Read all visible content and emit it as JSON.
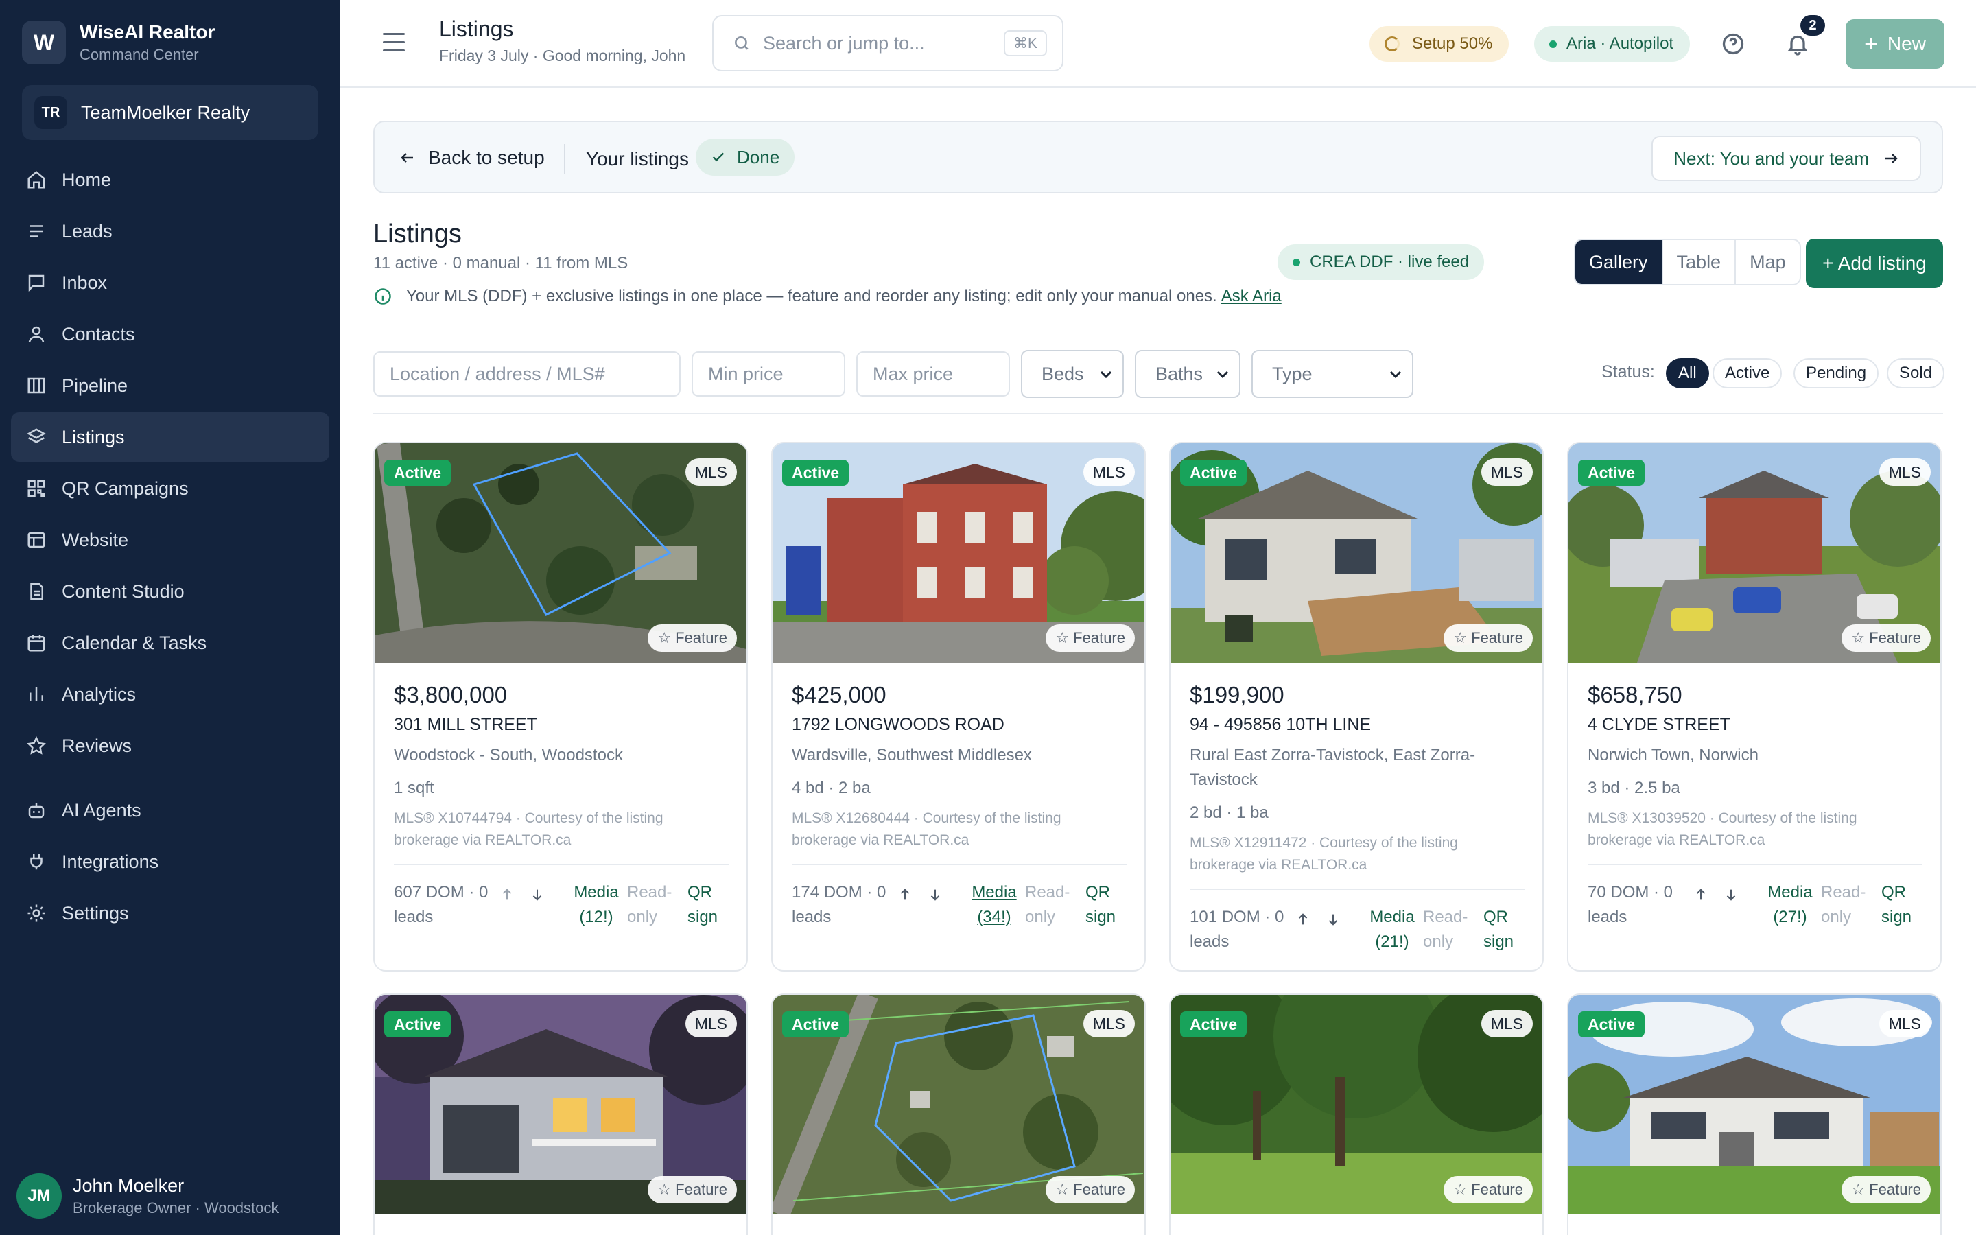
{
  "brand": {
    "logo": "W",
    "name": "WiseAI Realtor",
    "sub": "Command Center"
  },
  "team": {
    "initials": "TR",
    "name": "TeamMoelker Realty"
  },
  "nav": [
    {
      "label": "Home",
      "icon": "home-icon"
    },
    {
      "label": "Leads",
      "icon": "list-icon"
    },
    {
      "label": "Inbox",
      "icon": "inbox-icon"
    },
    {
      "label": "Contacts",
      "icon": "user-icon"
    },
    {
      "label": "Pipeline",
      "icon": "columns-icon"
    },
    {
      "label": "Listings",
      "icon": "layers-icon",
      "active": true
    },
    {
      "label": "QR Campaigns",
      "icon": "qr-icon"
    },
    {
      "label": "Website",
      "icon": "browser-icon"
    },
    {
      "label": "Content Studio",
      "icon": "document-icon"
    },
    {
      "label": "Calendar & Tasks",
      "icon": "calendar-icon"
    },
    {
      "label": "Analytics",
      "icon": "bar-chart-icon"
    },
    {
      "label": "Reviews",
      "icon": "star-icon"
    },
    {
      "label": "AI Agents",
      "icon": "bot-icon"
    },
    {
      "label": "Integrations",
      "icon": "plug-icon"
    },
    {
      "label": "Settings",
      "icon": "gear-icon"
    }
  ],
  "user": {
    "initials": "JM",
    "name": "John Moelker",
    "role": "Brokerage Owner · Woodstock"
  },
  "topbar": {
    "title": "Listings",
    "subtitle": "Friday 3 July · Good morning, John",
    "search_placeholder": "Search or jump to...",
    "shortcut": "⌘K",
    "setup_label": "Setup 50%",
    "setup_progress": 0.5,
    "aria_label": "Aria · Autopilot",
    "notifications": "2",
    "new_label": "New"
  },
  "setup_bar": {
    "back": "Back to setup",
    "step": "Your listings",
    "done": "Done",
    "next": "Next: You and your team"
  },
  "listings_header": {
    "title": "Listings",
    "counts": "11 active · 0 manual · 11 from MLS",
    "info": "Your MLS (DDF) + exclusive listings in one place — feature and reorder any listing; edit only your manual ones.",
    "ask_aria": "Ask Aria",
    "feed": "CREA DDF · live feed",
    "views": [
      "Gallery",
      "Table",
      "Map"
    ],
    "active_view": "Gallery",
    "add_listing": "+ Add listing"
  },
  "filters": {
    "location_placeholder": "Location / address / MLS#",
    "min_price_placeholder": "Min price",
    "max_price_placeholder": "Max price",
    "beds": "Beds",
    "baths": "Baths",
    "type": "Type",
    "status_label": "Status:",
    "statuses": [
      "All",
      "Active",
      "Pending",
      "Sold"
    ],
    "active_status": "All"
  },
  "card_labels": {
    "feature": "☆ Feature",
    "read_only": "Read-only",
    "qr_sign": "QR sign"
  },
  "listings": [
    {
      "status": "Active",
      "source": "MLS",
      "price": "$3,800,000",
      "address": "301 MILL STREET",
      "city": "Woodstock - South, Woodstock",
      "specs": "1 sqft",
      "mls": "MLS® X10744794 · Courtesy of the listing brokerage via REALTOR.ca",
      "dom": "607 DOM · 0 leads",
      "media": "Media (12!)"
    },
    {
      "status": "Active",
      "source": "MLS",
      "price": "$425,000",
      "address": "1792 LONGWOODS ROAD",
      "city": "Wardsville, Southwest Middlesex",
      "specs": "4 bd · 2 ba",
      "mls": "MLS® X12680444 · Courtesy of the listing brokerage via REALTOR.ca",
      "dom": "174 DOM · 0 leads",
      "media": "Media (34!)"
    },
    {
      "status": "Active",
      "source": "MLS",
      "price": "$199,900",
      "address": "94 - 495856 10TH LINE",
      "city": "Rural East Zorra-Tavistock, East Zorra-Tavistock",
      "specs": "2 bd · 1 ba",
      "mls": "MLS® X12911472 · Courtesy of the listing brokerage via REALTOR.ca",
      "dom": "101 DOM · 0 leads",
      "media": "Media (21!)"
    },
    {
      "status": "Active",
      "source": "MLS",
      "price": "$658,750",
      "address": "4 CLYDE STREET",
      "city": "Norwich Town, Norwich",
      "specs": "3 bd · 2.5 ba",
      "mls": "MLS® X13039520 · Courtesy of the listing brokerage via REALTOR.ca",
      "dom": "70 DOM · 0 leads",
      "media": "Media (27!)"
    },
    {
      "status": "Active",
      "source": "MLS"
    },
    {
      "status": "Active",
      "source": "MLS"
    },
    {
      "status": "Active",
      "source": "MLS"
    },
    {
      "status": "Active",
      "source": "MLS"
    }
  ]
}
